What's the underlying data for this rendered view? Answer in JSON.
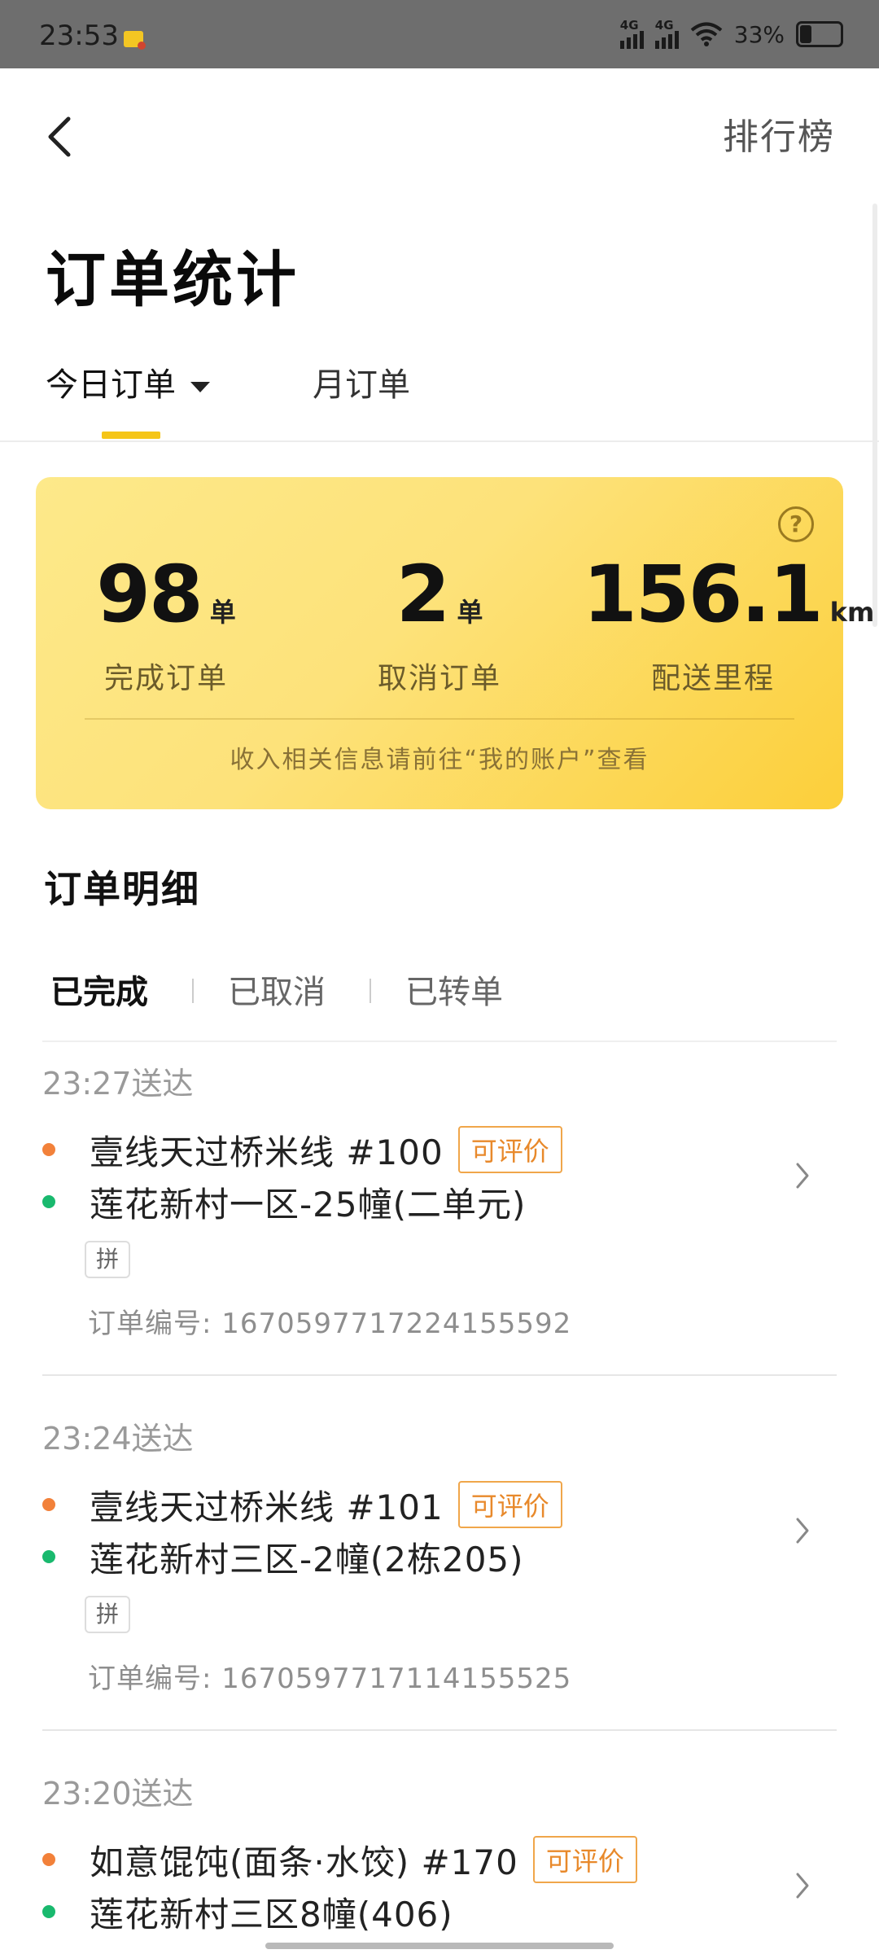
{
  "status_bar": {
    "time": "23:53",
    "signal1": "4G",
    "signal2": "4G",
    "battery": "33%"
  },
  "header": {
    "back_icon": "chevron-left-icon",
    "ranking_label": "排行榜",
    "title": "订单统计"
  },
  "tabs": {
    "today": "今日订单",
    "month": "月订单",
    "active": "today"
  },
  "summary": {
    "completed_value": "98",
    "completed_unit": "单",
    "completed_label": "完成订单",
    "cancelled_value": "2",
    "cancelled_unit": "单",
    "cancelled_label": "取消订单",
    "distance_value": "156.1",
    "distance_unit": "km",
    "distance_label": "配送里程",
    "note": "收入相关信息请前往“我的账户”查看",
    "help_icon": "question-circle-icon"
  },
  "details": {
    "title": "订单明细",
    "subtabs": [
      "已完成",
      "已取消",
      "已转单"
    ],
    "active_subtab": "已完成"
  },
  "orders": [
    {
      "time": "23:27送达",
      "shop": "壹线天过桥米线 #100",
      "badge": "可评价",
      "address": "莲花新村一区-25幢(二单元)",
      "tag": "拼",
      "order_no": "订单编号: 1670597717224155592"
    },
    {
      "time": "23:24送达",
      "shop": "壹线天过桥米线 #101",
      "badge": "可评价",
      "address": "莲花新村三区-2幢(2栋205)",
      "tag": "拼",
      "order_no": "订单编号: 1670597717114155525"
    },
    {
      "time": "23:20送达",
      "shop": "如意馄饨(面条·水饺) #170",
      "badge": "可评价",
      "address": "莲花新村三区8幢(406)"
    }
  ],
  "colors": {
    "accent": "#f5c518",
    "pickup_dot": "#f2813a",
    "dropoff_dot": "#19b96e",
    "badge": "#e8892b"
  }
}
